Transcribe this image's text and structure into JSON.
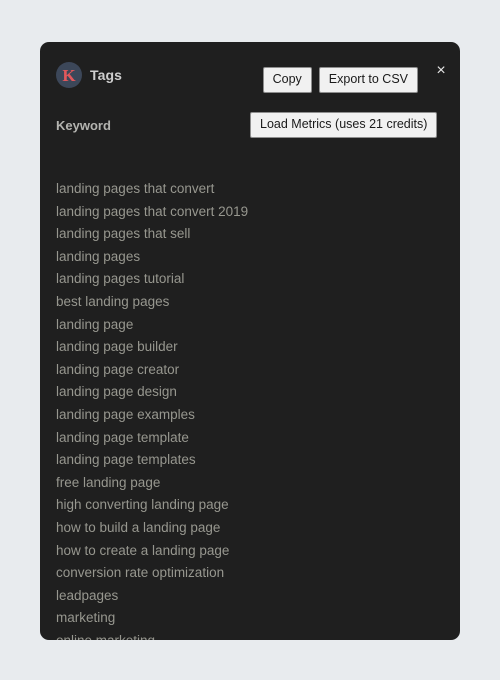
{
  "panel": {
    "brand": {
      "logo_letter": "K",
      "logo_icon": "keywords-everywhere-logo-icon",
      "logo_circle_color": "#3c4759",
      "logo_letter_color": "#e2585c",
      "title": "Tags"
    },
    "actions": {
      "copy_label": "Copy",
      "export_label": "Export to CSV",
      "close_icon": "close-icon",
      "close_glyph": "×"
    },
    "column_header": "Keyword",
    "load_metrics_label": "Load Metrics (uses 21 credits)",
    "colors": {
      "page_background": "#e8ebee",
      "panel_background": "#1f1f1f",
      "keyword_text": "#97978f",
      "header_text": "#cfcfcf",
      "button_background": "#f1f1f1"
    },
    "keywords": [
      "landing pages that convert",
      "landing pages that convert 2019",
      "landing pages that sell",
      "landing pages",
      "landing pages tutorial",
      "best landing pages",
      "landing page",
      "landing page builder",
      "landing page creator",
      "landing page design",
      "landing page examples",
      "landing page template",
      "landing page templates",
      "free landing page",
      "high converting landing page",
      "how to build a landing page",
      "how to create a landing page",
      "conversion rate optimization",
      "leadpages",
      "marketing",
      "online marketing"
    ]
  }
}
